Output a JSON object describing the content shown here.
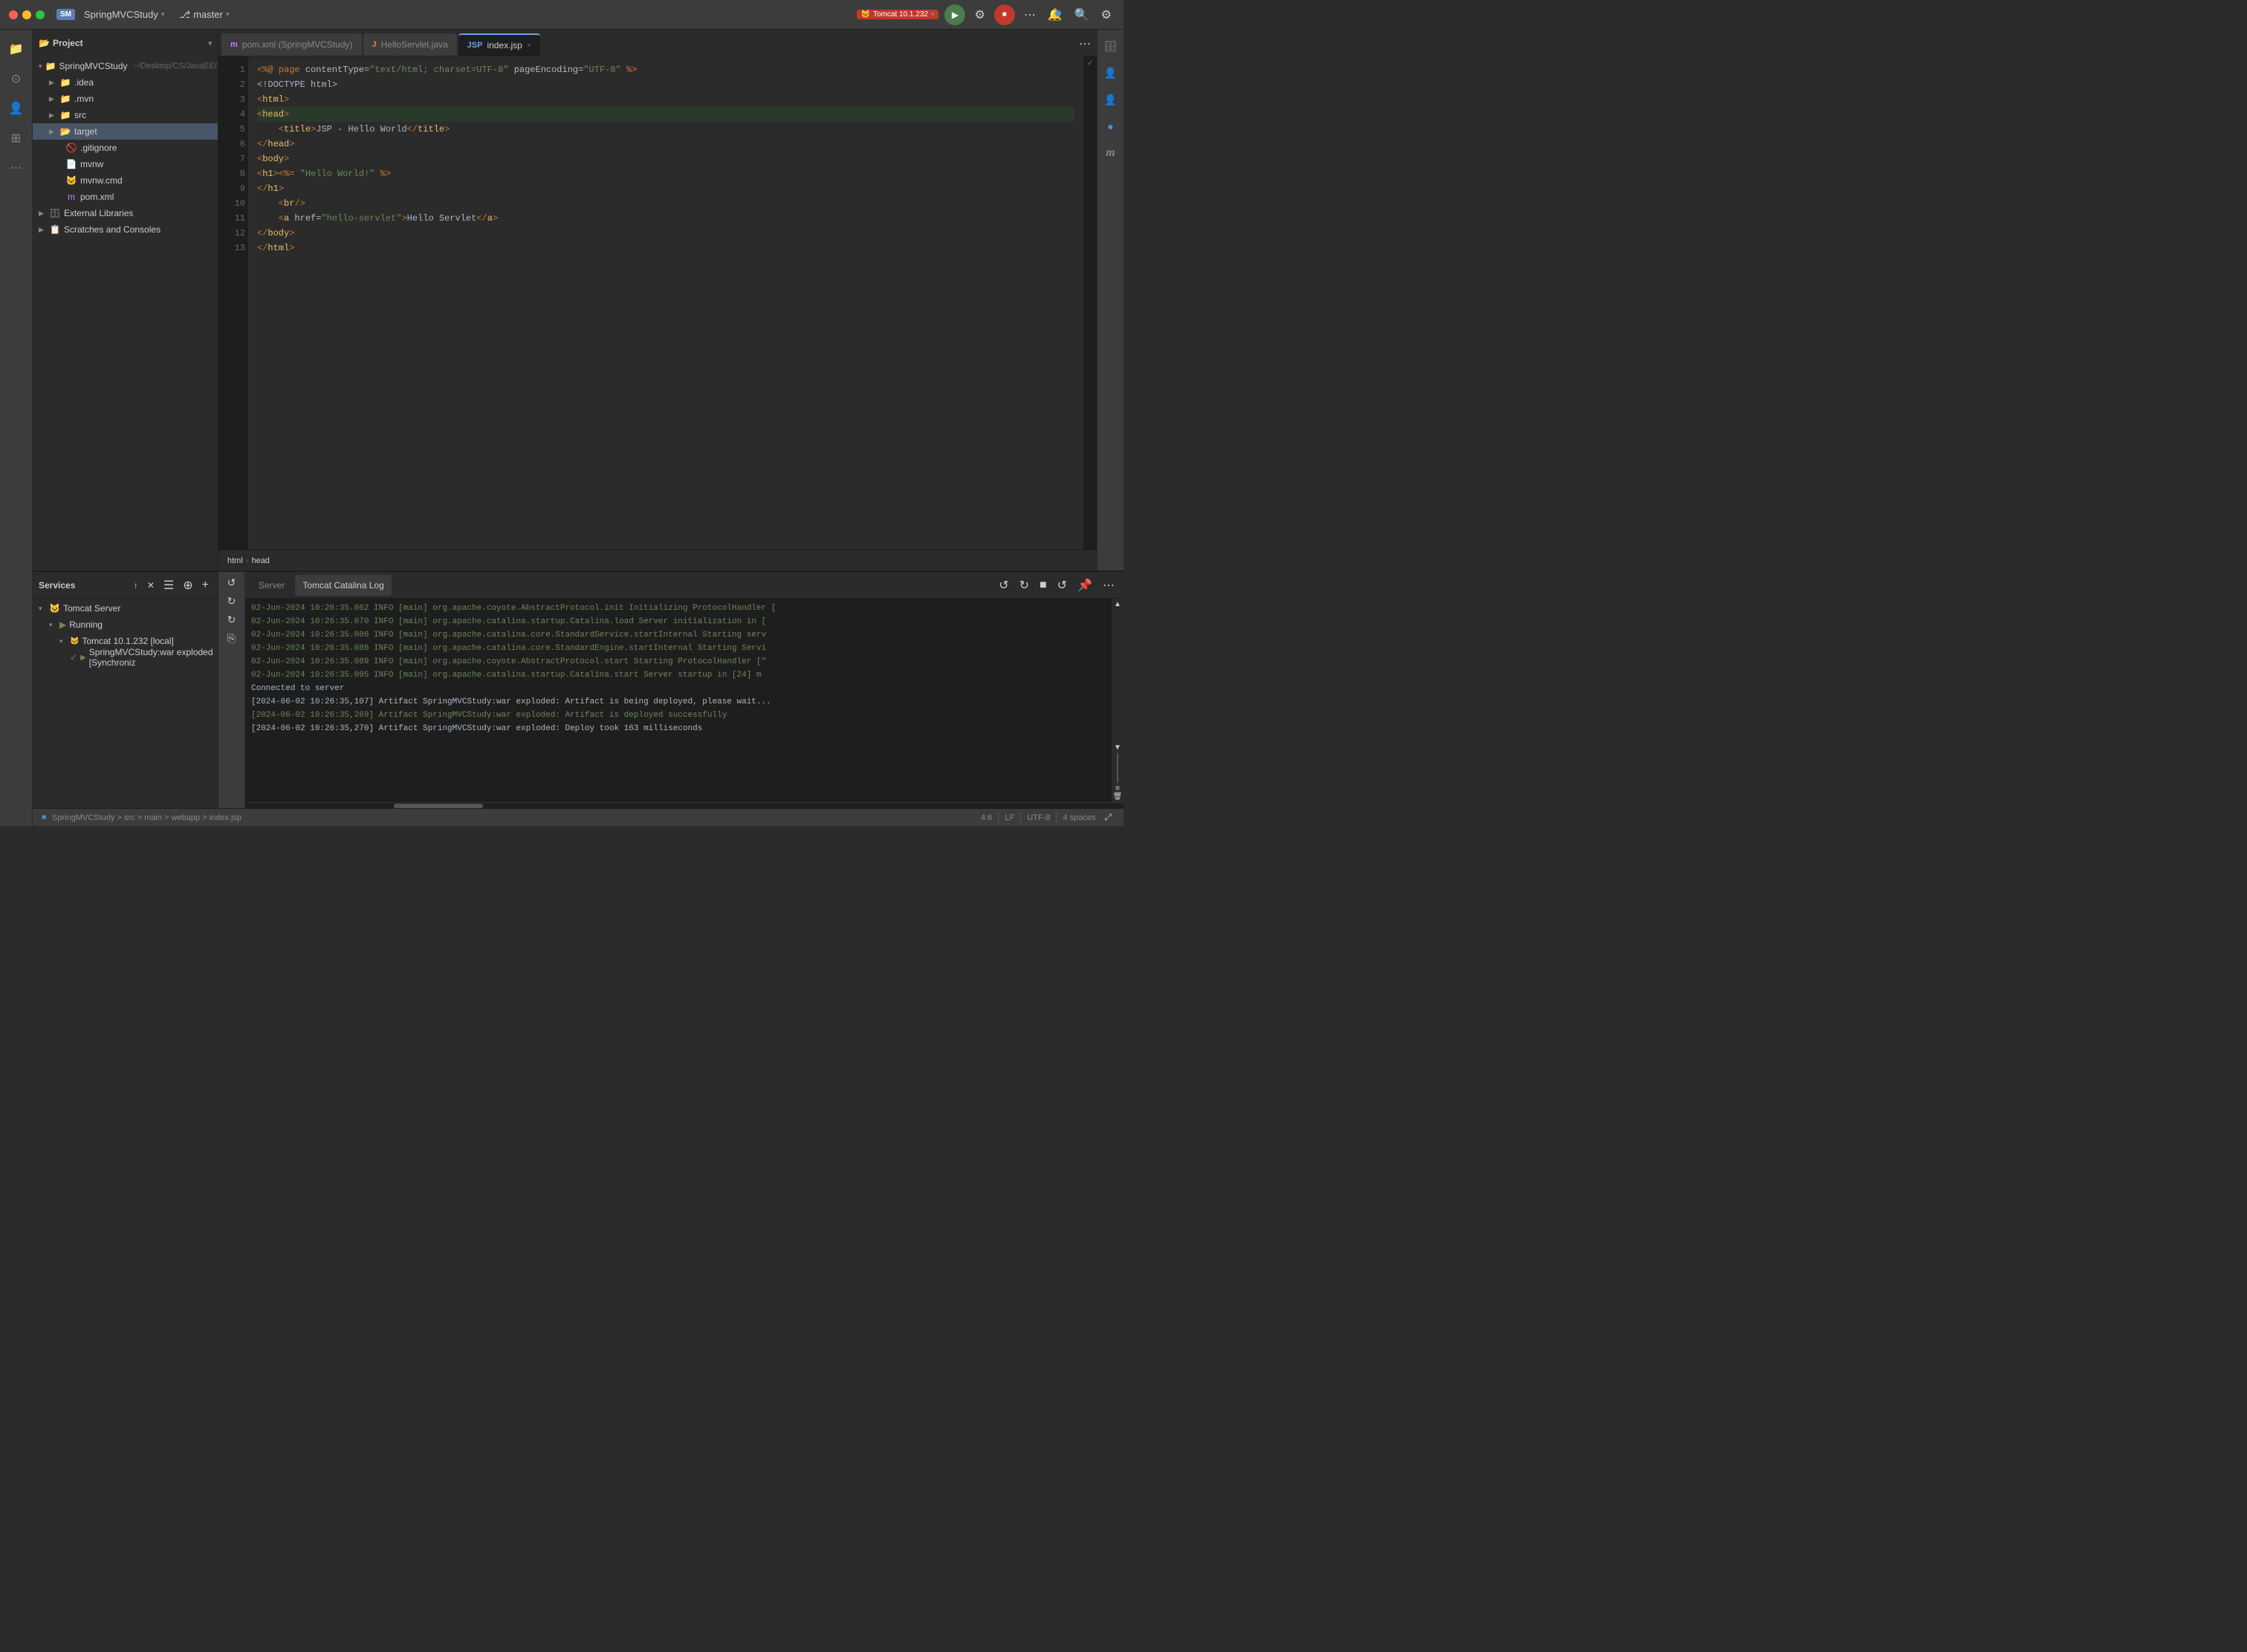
{
  "titlebar": {
    "project_badge": "SM",
    "project_name": "SpringMVCStudy",
    "branch_icon": "⎇",
    "branch_name": "master",
    "run_config": "Tomcat 10.1.232",
    "chevron": "▾"
  },
  "tabs": [
    {
      "id": "pom",
      "icon_type": "m",
      "label": "pom.xml (SpringMVCStudy)",
      "active": false,
      "closable": false
    },
    {
      "id": "hello",
      "icon_type": "java",
      "label": "HelloServlet.java",
      "active": false,
      "closable": false
    },
    {
      "id": "index",
      "icon_type": "jsp",
      "label": "index.jsp",
      "active": true,
      "closable": true
    }
  ],
  "editor": {
    "lines": [
      {
        "num": 1,
        "content": "<%@ page contentType=\"text/html; charset=UTF-8\" pageEncoding=\"UTF-8\" %>"
      },
      {
        "num": 2,
        "content": "<!DOCTYPE html>"
      },
      {
        "num": 3,
        "content": "<html>"
      },
      {
        "num": 4,
        "content": "<head>"
      },
      {
        "num": 5,
        "content": "    <title>JSP - Hello World</title>"
      },
      {
        "num": 6,
        "content": "</head>"
      },
      {
        "num": 7,
        "content": "<body>"
      },
      {
        "num": 8,
        "content": "<h1><%= \"Hello World!\" %></h1>"
      },
      {
        "num": 9,
        "content": "</h1>"
      },
      {
        "num": 10,
        "content": "    <br/>"
      },
      {
        "num": 11,
        "content": "    <a href=\"hello-servlet\">Hello Servlet</a>"
      },
      {
        "num": 12,
        "content": "</body>"
      },
      {
        "num": 13,
        "content": "</html>"
      }
    ]
  },
  "breadcrumb": {
    "items": [
      "html",
      "head"
    ]
  },
  "file_tree": {
    "root_label": "Project",
    "items": [
      {
        "id": "spring",
        "label": "SpringMVCStudy",
        "suffix": "~/Desktop/CS/JavaEE/S",
        "type": "root",
        "expanded": true,
        "level": 0
      },
      {
        "id": "idea",
        "label": ".idea",
        "type": "folder",
        "expanded": false,
        "level": 1
      },
      {
        "id": "mvn",
        "label": ".mvn",
        "type": "folder",
        "expanded": false,
        "level": 1
      },
      {
        "id": "src",
        "label": "src",
        "type": "folder",
        "expanded": false,
        "level": 1
      },
      {
        "id": "target",
        "label": "target",
        "type": "folder_open",
        "expanded": false,
        "level": 1,
        "selected": true
      },
      {
        "id": "gitignore",
        "label": ".gitignore",
        "type": "file",
        "level": 1
      },
      {
        "id": "mvnw",
        "label": "mvnw",
        "type": "file",
        "level": 1
      },
      {
        "id": "mvnw_cmd",
        "label": "mvnw.cmd",
        "type": "file",
        "level": 1
      },
      {
        "id": "pom_xml",
        "label": "pom.xml",
        "type": "file_pom",
        "level": 1
      },
      {
        "id": "ext_libs",
        "label": "External Libraries",
        "type": "ext",
        "level": 0
      },
      {
        "id": "scratches",
        "label": "Scratches and Consoles",
        "type": "scratches",
        "level": 0
      }
    ]
  },
  "services": {
    "title": "Services",
    "items": [
      {
        "id": "tomcat_server",
        "label": "Tomcat Server",
        "type": "server",
        "expanded": true,
        "level": 0
      },
      {
        "id": "running",
        "label": "Running",
        "type": "group",
        "expanded": true,
        "level": 1
      },
      {
        "id": "tomcat_inst",
        "label": "Tomcat 10.1.232 [local]",
        "type": "instance",
        "expanded": true,
        "level": 2
      },
      {
        "id": "war",
        "label": "SpringMVCStudy:war exploded [Synchroniz",
        "type": "war",
        "level": 3
      }
    ]
  },
  "log": {
    "tabs": [
      "Server",
      "Tomcat Catalina Log"
    ],
    "active_tab": "Tomcat Catalina Log",
    "lines": [
      "02-Jun-2024 10:26:35.062 INFO [main] org.apache.coyote.AbstractProtocol.init Initializing ProtocolHandler [",
      "02-Jun-2024 10:26:35.070 INFO [main] org.apache.catalina.startup.Catalina.load Server initialization in [",
      "02-Jun-2024 10:26:35.086 INFO [main] org.apache.catalina.core.StandardService.startInternal Starting serv",
      "02-Jun-2024 10:26:35.086 INFO [main] org.apache.catalina.core.StandardEngine.startInternal Starting Servi",
      "02-Jun-2024 10:26:35.089 INFO [main] org.apache.coyote.AbstractProtocol.start Starting ProtocolHandler [\"",
      "02-Jun-2024 10:26:35.095 INFO [main] org.apache.catalina.startup.Catalina.start Server startup in [24] m",
      "Connected to server",
      "[2024-06-02 10:26:35,107] Artifact SpringMVCStudy:war exploded: Artifact is being deployed, please wait...",
      "[2024-06-02 10:26:35,269] Artifact SpringMVCStudy:war exploded: Artifact is deployed successfully",
      "[2024-06-02 10:26:35,270] Artifact SpringMVCStudy:war exploded: Deploy took 163 milliseconds"
    ]
  },
  "statusbar": {
    "breadcrumb": "SpringMVCStudy > src > main > webapp > index.jsp",
    "position": "4:6",
    "line_ending": "LF",
    "encoding": "UTF-8",
    "indent": "4 spaces"
  }
}
